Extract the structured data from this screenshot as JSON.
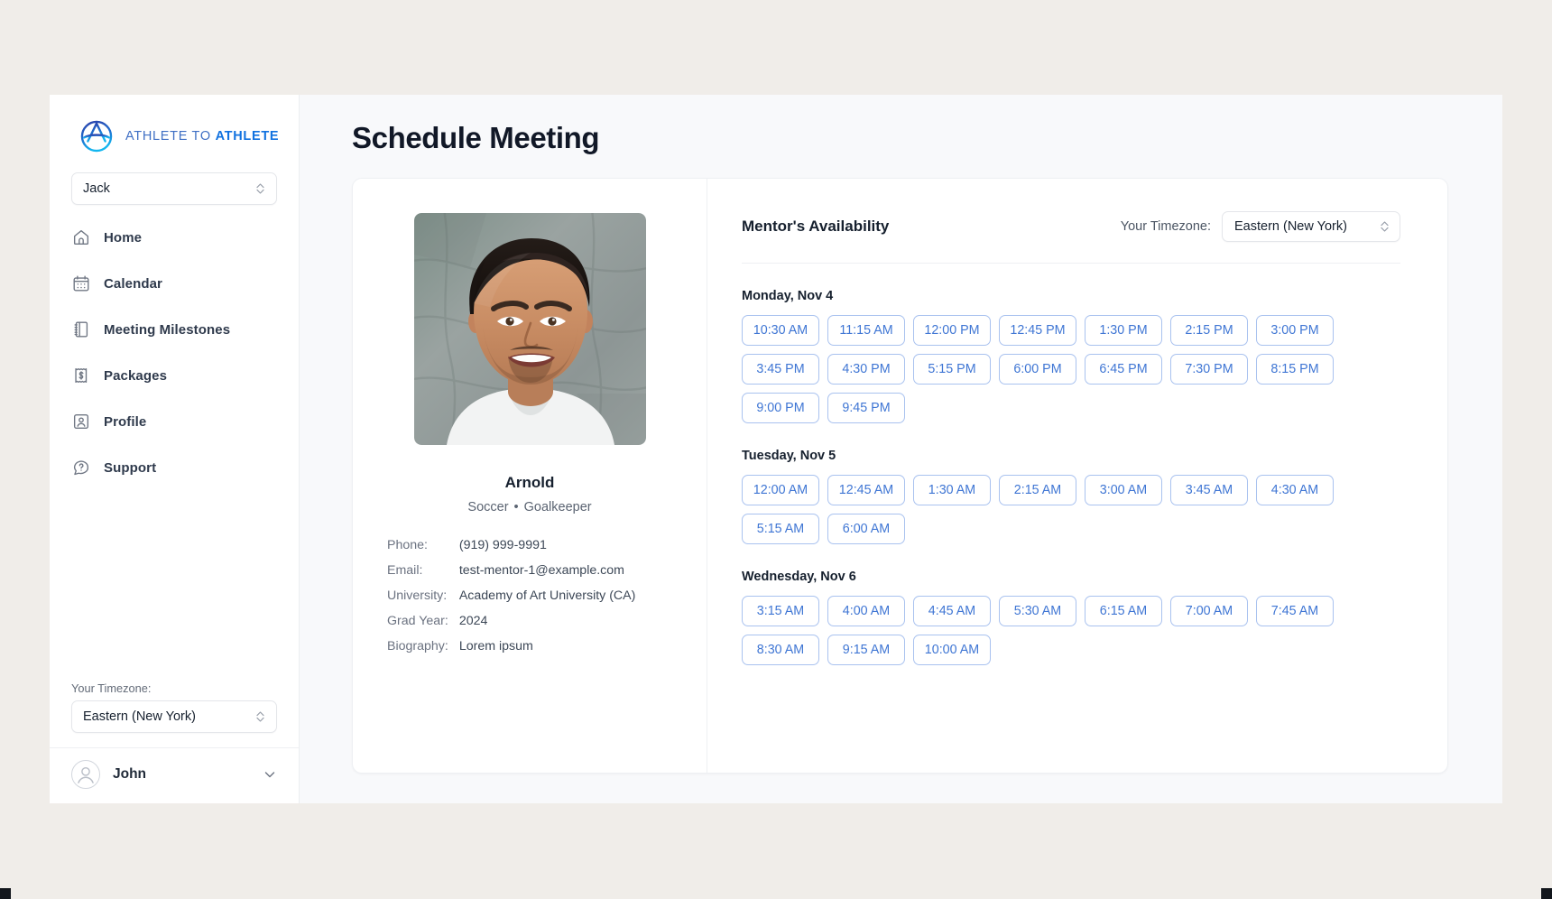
{
  "brand": {
    "logo_icon": "athlete-to-athlete-logo",
    "text_light": "ATHLETE TO ",
    "text_bold": "ATHLETE"
  },
  "sidebar": {
    "account_select": {
      "value": "Jack",
      "icon": "up-down-chevron-icon"
    },
    "items": [
      {
        "label": "Home",
        "icon": "home-icon"
      },
      {
        "label": "Calendar",
        "icon": "calendar-icon"
      },
      {
        "label": "Meeting Milestones",
        "icon": "notebook-icon"
      },
      {
        "label": "Packages",
        "icon": "receipt-dollar-icon"
      },
      {
        "label": "Profile",
        "icon": "user-card-icon"
      },
      {
        "label": "Support",
        "icon": "question-chat-icon"
      }
    ],
    "timezone_label": "Your Timezone:",
    "timezone_value": "Eastern (New York)",
    "user": {
      "name": "John",
      "avatar_icon": "user-avatar-icon",
      "chevron_icon": "chevron-down-icon"
    }
  },
  "main": {
    "page_title": "Schedule Meeting"
  },
  "mentor": {
    "photo_alt": "mentor-headshot",
    "name": "Arnold",
    "sport": "Soccer",
    "separator": "•",
    "position": "Goalkeeper",
    "facts": [
      {
        "key": "Phone:",
        "value": "(919) 999-9991"
      },
      {
        "key": "Email:",
        "value": "test-mentor-1@example.com"
      },
      {
        "key": "University:",
        "value": "Academy of Art University (CA)"
      },
      {
        "key": "Grad Year:",
        "value": "2024"
      },
      {
        "key": "Biography:",
        "value": "Lorem ipsum"
      }
    ]
  },
  "availability": {
    "title": "Mentor's Availability",
    "timezone_label": "Your Timezone:",
    "timezone_value": "Eastern (New York)",
    "days": [
      {
        "title": "Monday, Nov 4",
        "slots": [
          "10:30 AM",
          "11:15 AM",
          "12:00 PM",
          "12:45 PM",
          "1:30 PM",
          "2:15 PM",
          "3:00 PM",
          "3:45 PM",
          "4:30 PM",
          "5:15 PM",
          "6:00 PM",
          "6:45 PM",
          "7:30 PM",
          "8:15 PM",
          "9:00 PM",
          "9:45 PM"
        ]
      },
      {
        "title": "Tuesday, Nov 5",
        "slots": [
          "12:00 AM",
          "12:45 AM",
          "1:30 AM",
          "2:15 AM",
          "3:00 AM",
          "3:45 AM",
          "4:30 AM",
          "5:15 AM",
          "6:00 AM"
        ]
      },
      {
        "title": "Wednesday, Nov 6",
        "slots": [
          "3:15 AM",
          "4:00 AM",
          "4:45 AM",
          "5:30 AM",
          "6:15 AM",
          "7:00 AM",
          "7:45 AM",
          "8:30 AM",
          "9:15 AM",
          "10:00 AM"
        ]
      }
    ]
  },
  "colors": {
    "page_background": "#f0ede9",
    "app_background": "#f8f9fb",
    "brand_blue": "#1172e0",
    "slot_border": "#a9c2ef",
    "slot_text": "#3f76d4",
    "text_dark": "#16202e"
  }
}
